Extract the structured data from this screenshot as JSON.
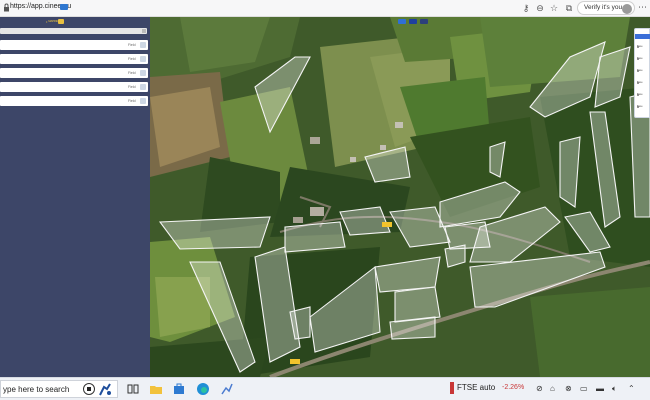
{
  "browser": {
    "url": "https://app.cinee.eu",
    "user_label": "Verify it's you"
  },
  "sidebar": {
    "header_label": "• ᴹᴬᴾᴵᴺᴳ",
    "rows": [
      {
        "label": "Field"
      },
      {
        "label": "Field"
      },
      {
        "label": "Field"
      },
      {
        "label": "Field"
      },
      {
        "label": "Field"
      }
    ]
  },
  "map": {
    "right_panel_items": [
      "Base",
      "Base",
      "Base",
      "Base",
      "Base",
      "Base"
    ]
  },
  "taskbar": {
    "search_placeholder": "ype here to search",
    "weather_text": "FTSE auto",
    "stock_change": "-2.26%"
  },
  "colors": {
    "sidebar_bg": "#3d4668",
    "accent": "#2f77d0",
    "polygon_fill": "#ffffff",
    "stock_negative": "#c83737"
  }
}
